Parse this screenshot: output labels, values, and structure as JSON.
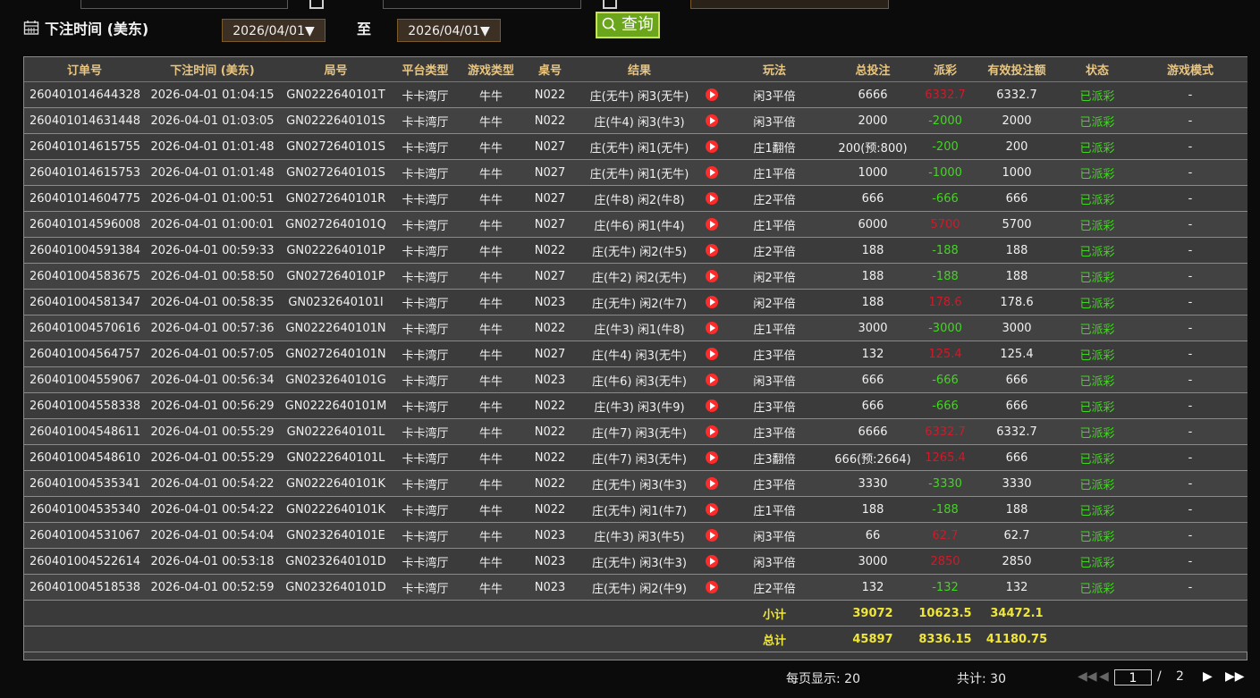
{
  "filter": {
    "label": "下注时间 (美东)",
    "date_from": "2026/04/01▼",
    "to_label": "至",
    "date_to": "2026/04/01▼",
    "search_label": "查询"
  },
  "table": {
    "headers": [
      "订单号",
      "下注时间 (美东)",
      "局号",
      "平台类型",
      "游戏类型",
      "桌号",
      "结果",
      "",
      "玩法",
      "总投注",
      "派彩",
      "有效投注额",
      "状态",
      "游戏模式"
    ],
    "rows": [
      [
        "260401014644328",
        "2026-04-01 01:04:15",
        "GN0222640101T",
        "卡卡湾厅",
        "牛牛",
        "N022",
        "庄(无牛) 闲3(无牛)",
        "闲3平倍",
        "6666",
        "6332.7",
        "6332.7",
        "已派彩",
        "-"
      ],
      [
        "260401014631448",
        "2026-04-01 01:03:05",
        "GN0222640101S",
        "卡卡湾厅",
        "牛牛",
        "N022",
        "庄(牛4) 闲3(牛3)",
        "闲3平倍",
        "2000",
        "-2000",
        "2000",
        "已派彩",
        "-"
      ],
      [
        "260401014615755",
        "2026-04-01 01:01:48",
        "GN0272640101S",
        "卡卡湾厅",
        "牛牛",
        "N027",
        "庄(无牛) 闲1(无牛)",
        "庄1翻倍",
        "200(预:800)",
        "-200",
        "200",
        "已派彩",
        "-"
      ],
      [
        "260401014615753",
        "2026-04-01 01:01:48",
        "GN0272640101S",
        "卡卡湾厅",
        "牛牛",
        "N027",
        "庄(无牛) 闲1(无牛)",
        "庄1平倍",
        "1000",
        "-1000",
        "1000",
        "已派彩",
        "-"
      ],
      [
        "260401014604775",
        "2026-04-01 01:00:51",
        "GN0272640101R",
        "卡卡湾厅",
        "牛牛",
        "N027",
        "庄(牛8) 闲2(牛8)",
        "庄2平倍",
        "666",
        "-666",
        "666",
        "已派彩",
        "-"
      ],
      [
        "260401014596008",
        "2026-04-01 01:00:01",
        "GN0272640101Q",
        "卡卡湾厅",
        "牛牛",
        "N027",
        "庄(牛6) 闲1(牛4)",
        "庄1平倍",
        "6000",
        "5700",
        "5700",
        "已派彩",
        "-"
      ],
      [
        "260401004591384",
        "2026-04-01 00:59:33",
        "GN0222640101P",
        "卡卡湾厅",
        "牛牛",
        "N022",
        "庄(无牛) 闲2(牛5)",
        "庄2平倍",
        "188",
        "-188",
        "188",
        "已派彩",
        "-"
      ],
      [
        "260401004583675",
        "2026-04-01 00:58:50",
        "GN0272640101P",
        "卡卡湾厅",
        "牛牛",
        "N027",
        "庄(牛2) 闲2(无牛)",
        "闲2平倍",
        "188",
        "-188",
        "188",
        "已派彩",
        "-"
      ],
      [
        "260401004581347",
        "2026-04-01 00:58:35",
        "GN0232640101I",
        "卡卡湾厅",
        "牛牛",
        "N023",
        "庄(无牛) 闲2(牛7)",
        "闲2平倍",
        "188",
        "178.6",
        "178.6",
        "已派彩",
        "-"
      ],
      [
        "260401004570616",
        "2026-04-01 00:57:36",
        "GN0222640101N",
        "卡卡湾厅",
        "牛牛",
        "N022",
        "庄(牛3) 闲1(牛8)",
        "庄1平倍",
        "3000",
        "-3000",
        "3000",
        "已派彩",
        "-"
      ],
      [
        "260401004564757",
        "2026-04-01 00:57:05",
        "GN0272640101N",
        "卡卡湾厅",
        "牛牛",
        "N027",
        "庄(牛4) 闲3(无牛)",
        "庄3平倍",
        "132",
        "125.4",
        "125.4",
        "已派彩",
        "-"
      ],
      [
        "260401004559067",
        "2026-04-01 00:56:34",
        "GN0232640101G",
        "卡卡湾厅",
        "牛牛",
        "N023",
        "庄(牛6) 闲3(无牛)",
        "闲3平倍",
        "666",
        "-666",
        "666",
        "已派彩",
        "-"
      ],
      [
        "260401004558338",
        "2026-04-01 00:56:29",
        "GN0222640101M",
        "卡卡湾厅",
        "牛牛",
        "N022",
        "庄(牛3) 闲3(牛9)",
        "庄3平倍",
        "666",
        "-666",
        "666",
        "已派彩",
        "-"
      ],
      [
        "260401004548611",
        "2026-04-01 00:55:29",
        "GN0222640101L",
        "卡卡湾厅",
        "牛牛",
        "N022",
        "庄(牛7) 闲3(无牛)",
        "庄3平倍",
        "6666",
        "6332.7",
        "6332.7",
        "已派彩",
        "-"
      ],
      [
        "260401004548610",
        "2026-04-01 00:55:29",
        "GN0222640101L",
        "卡卡湾厅",
        "牛牛",
        "N022",
        "庄(牛7) 闲3(无牛)",
        "庄3翻倍",
        "666(预:2664)",
        "1265.4",
        "666",
        "已派彩",
        "-"
      ],
      [
        "260401004535341",
        "2026-04-01 00:54:22",
        "GN0222640101K",
        "卡卡湾厅",
        "牛牛",
        "N022",
        "庄(无牛) 闲3(牛3)",
        "庄3平倍",
        "3330",
        "-3330",
        "3330",
        "已派彩",
        "-"
      ],
      [
        "260401004535340",
        "2026-04-01 00:54:22",
        "GN0222640101K",
        "卡卡湾厅",
        "牛牛",
        "N022",
        "庄(无牛) 闲1(牛7)",
        "庄1平倍",
        "188",
        "-188",
        "188",
        "已派彩",
        "-"
      ],
      [
        "260401004531067",
        "2026-04-01 00:54:04",
        "GN0232640101E",
        "卡卡湾厅",
        "牛牛",
        "N023",
        "庄(牛3) 闲3(牛5)",
        "闲3平倍",
        "66",
        "62.7",
        "62.7",
        "已派彩",
        "-"
      ],
      [
        "260401004522614",
        "2026-04-01 00:53:18",
        "GN0232640101D",
        "卡卡湾厅",
        "牛牛",
        "N023",
        "庄(无牛) 闲3(牛3)",
        "闲3平倍",
        "3000",
        "2850",
        "2850",
        "已派彩",
        "-"
      ],
      [
        "260401004518538",
        "2026-04-01 00:52:59",
        "GN0232640101D",
        "卡卡湾厅",
        "牛牛",
        "N023",
        "庄(无牛) 闲2(牛9)",
        "庄2平倍",
        "132",
        "-132",
        "132",
        "已派彩",
        "-"
      ]
    ],
    "subtotal": {
      "label": "小计",
      "total_bet": "39072",
      "payout": "10623.5",
      "valid_bet": "34472.1"
    },
    "total": {
      "label": "总计",
      "total_bet": "45897",
      "payout": "8336.15",
      "valid_bet": "41180.75"
    }
  },
  "pager": {
    "per_page": "每页显示: 20",
    "total": "共计: 30",
    "current_page": "1",
    "separator": "/",
    "page_count": "2"
  },
  "colors": {
    "negative": "#3fd81c",
    "positive": "#d01a2a",
    "status": "#3fd81c",
    "accent": "#6aa51b"
  }
}
